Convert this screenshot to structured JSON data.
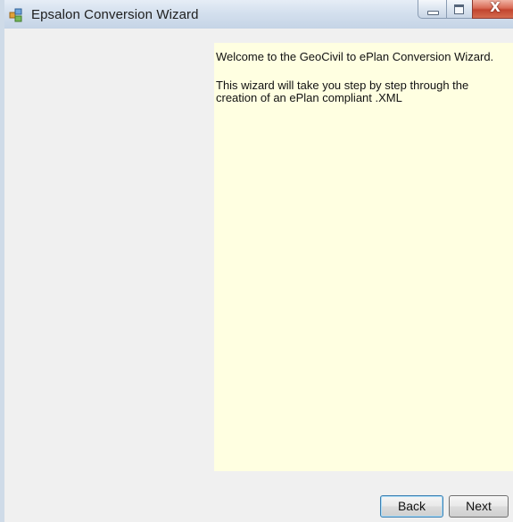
{
  "window": {
    "title": "Epsalon Conversion Wizard",
    "icon": "app-window-icon",
    "caption_buttons": {
      "minimize_icon": "minimize-icon",
      "maximize_icon": "maximize-icon",
      "close_glyph": "X"
    }
  },
  "content": {
    "welcome_text": "Welcome to the GeoCivil to ePlan Conversion Wizard.",
    "description_text": "This wizard will take you step by step through the creation of an ePlan compliant .XML"
  },
  "buttons": {
    "back_label": "Back",
    "next_label": "Next"
  },
  "colors": {
    "panel_background": "#ffffe1",
    "window_background": "#f0f0f0",
    "close_button": "#c2452f"
  }
}
